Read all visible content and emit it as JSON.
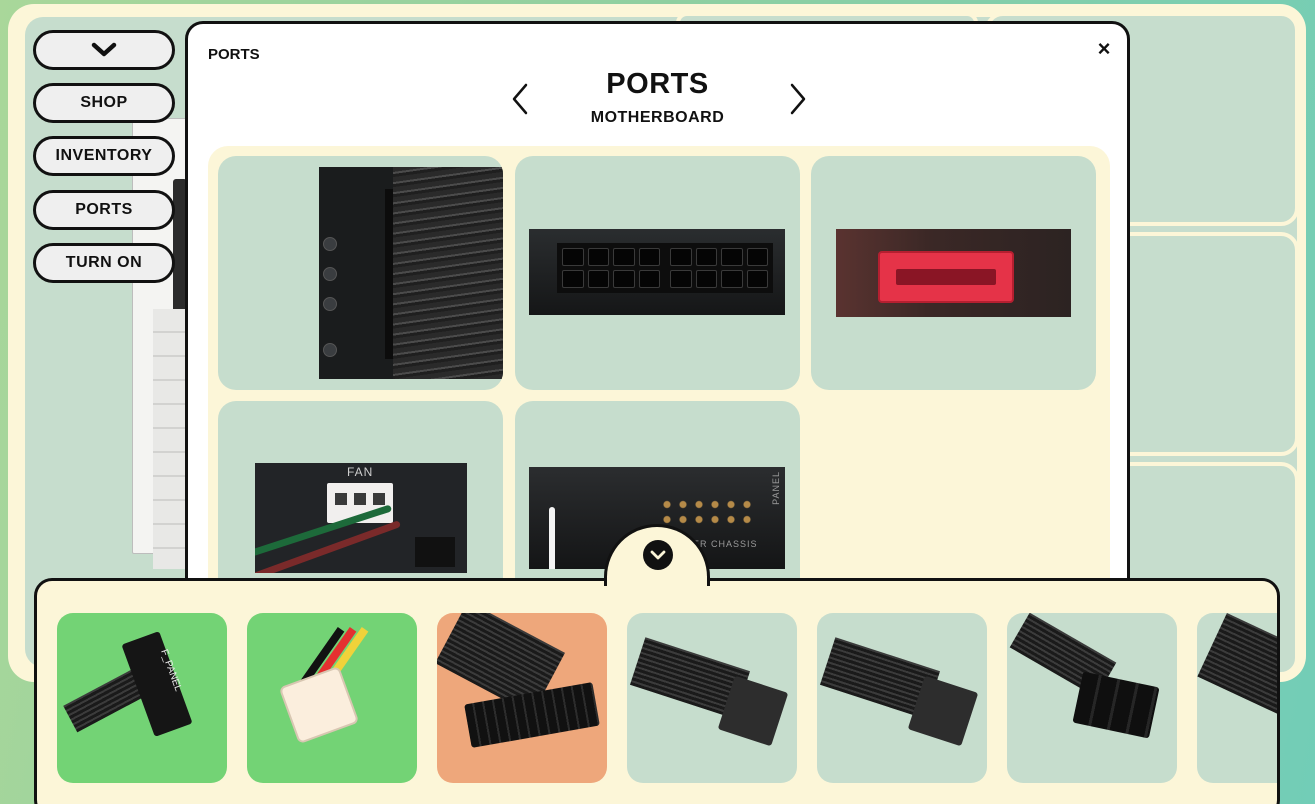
{
  "sidebar": {
    "toggle_icon": "chevron-down-icon",
    "items": [
      {
        "label": "SHOP"
      },
      {
        "label": "INVENTORY"
      },
      {
        "label": "PORTS"
      },
      {
        "label": "TURN ON"
      }
    ]
  },
  "modal": {
    "corner_title": "PORTS",
    "close_label": "×",
    "title": "PORTS",
    "subtitle": "MOTHERBOARD",
    "prev_icon": "chevron-left-icon",
    "next_icon": "chevron-right-icon",
    "ports": [
      {
        "icon": "atx-24pin-port-photo"
      },
      {
        "icon": "cpu-8pin-port-photo"
      },
      {
        "icon": "sata-port-photo"
      },
      {
        "icon": "fan-header-photo",
        "printed_text": "FAN"
      },
      {
        "icon": "front-panel-header-photo",
        "printed_text": "AKER CHASSIS",
        "side_text": "PANEL"
      }
    ]
  },
  "tray": {
    "toggle_icon": "chevron-down-icon",
    "cables": [
      {
        "icon": "front-panel-cable-photo",
        "printed_text": "F_PANEL",
        "bg": "#73d375"
      },
      {
        "icon": "fan-3pin-cable-photo",
        "bg": "#73d375"
      },
      {
        "icon": "atx-24pin-cable-photo",
        "bg": "#eea77b"
      },
      {
        "icon": "pcie-8pin-cable-photo",
        "bg": "#c6ddcd"
      },
      {
        "icon": "pcie-8pin-cable-photo",
        "bg": "#c6ddcd"
      },
      {
        "icon": "cpu-8pin-cable-photo",
        "bg": "#c6ddcd"
      },
      {
        "icon": "sleeved-cable-photo",
        "bg": "#c6ddcd"
      }
    ]
  },
  "colors": {
    "cream": "#fcf6d8",
    "tile": "#c6ddcd",
    "connected": "#73d375",
    "selected": "#eea77b",
    "outline": "#111111"
  }
}
